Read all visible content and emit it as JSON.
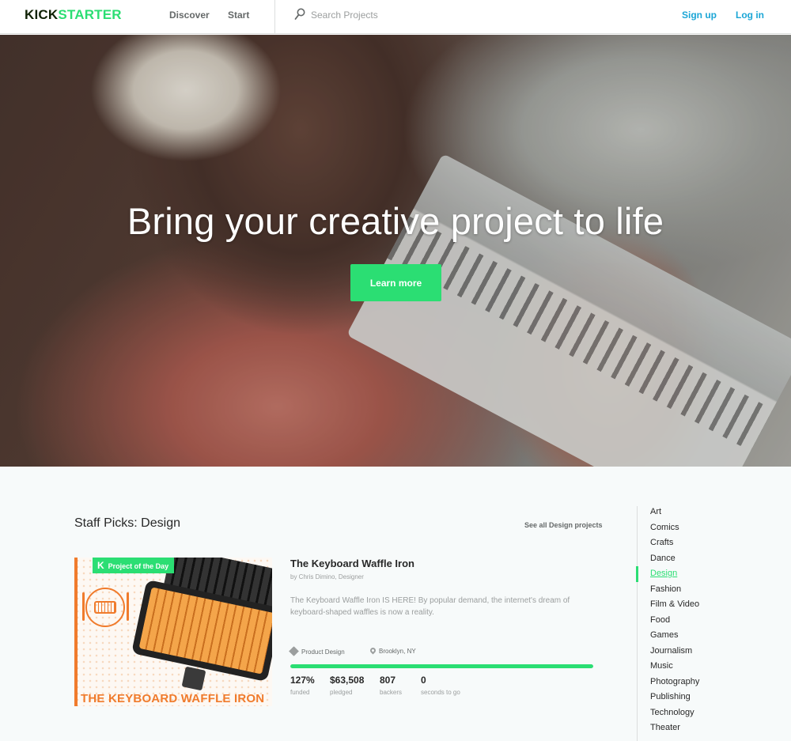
{
  "header": {
    "logo_dark": "KICK",
    "logo_green": "STARTER",
    "nav": {
      "discover": "Discover",
      "start": "Start"
    },
    "search": {
      "placeholder": "Search Projects"
    },
    "signup": "Sign up",
    "login": "Log in"
  },
  "hero": {
    "title": "Bring your creative project to life",
    "button": "Learn more"
  },
  "staff_picks": {
    "title": "Staff Picks:  Design",
    "see_all": "See all Design projects"
  },
  "project": {
    "badge": "Project of the Day",
    "badge_k": "K",
    "image_caption": "THE KEYBOARD WAFFLE IRON",
    "title": "The Keyboard Waffle Iron",
    "by": "by Chris Dimino, Designer",
    "blurb": "The Keyboard Waffle Iron IS HERE! By popular demand, the internet's dream of keyboard-shaped waffles is now a reality.",
    "category": "Product Design",
    "location": "Brooklyn, NY",
    "progress_fraction": 1.0,
    "stats": [
      {
        "value": "127%",
        "label": "funded"
      },
      {
        "value": "$63,508",
        "label": "pledged"
      },
      {
        "value": "807",
        "label": "backers"
      },
      {
        "value": "0",
        "label": "seconds to go"
      }
    ]
  },
  "categories": {
    "items": [
      "Art",
      "Comics",
      "Crafts",
      "Dance",
      "Design",
      "Fashion",
      "Film & Video",
      "Food",
      "Games",
      "Journalism",
      "Music",
      "Photography",
      "Publishing",
      "Technology",
      "Theater"
    ],
    "active": "Design"
  },
  "colors": {
    "brand_green": "#2bde73",
    "brand_dark": "#0f2105",
    "link_blue": "#1ba6d6",
    "accent_orange": "#f07b2c"
  },
  "icons": [
    "search-icon",
    "tag-icon",
    "location-pin-icon",
    "kickstarter-k-icon"
  ]
}
